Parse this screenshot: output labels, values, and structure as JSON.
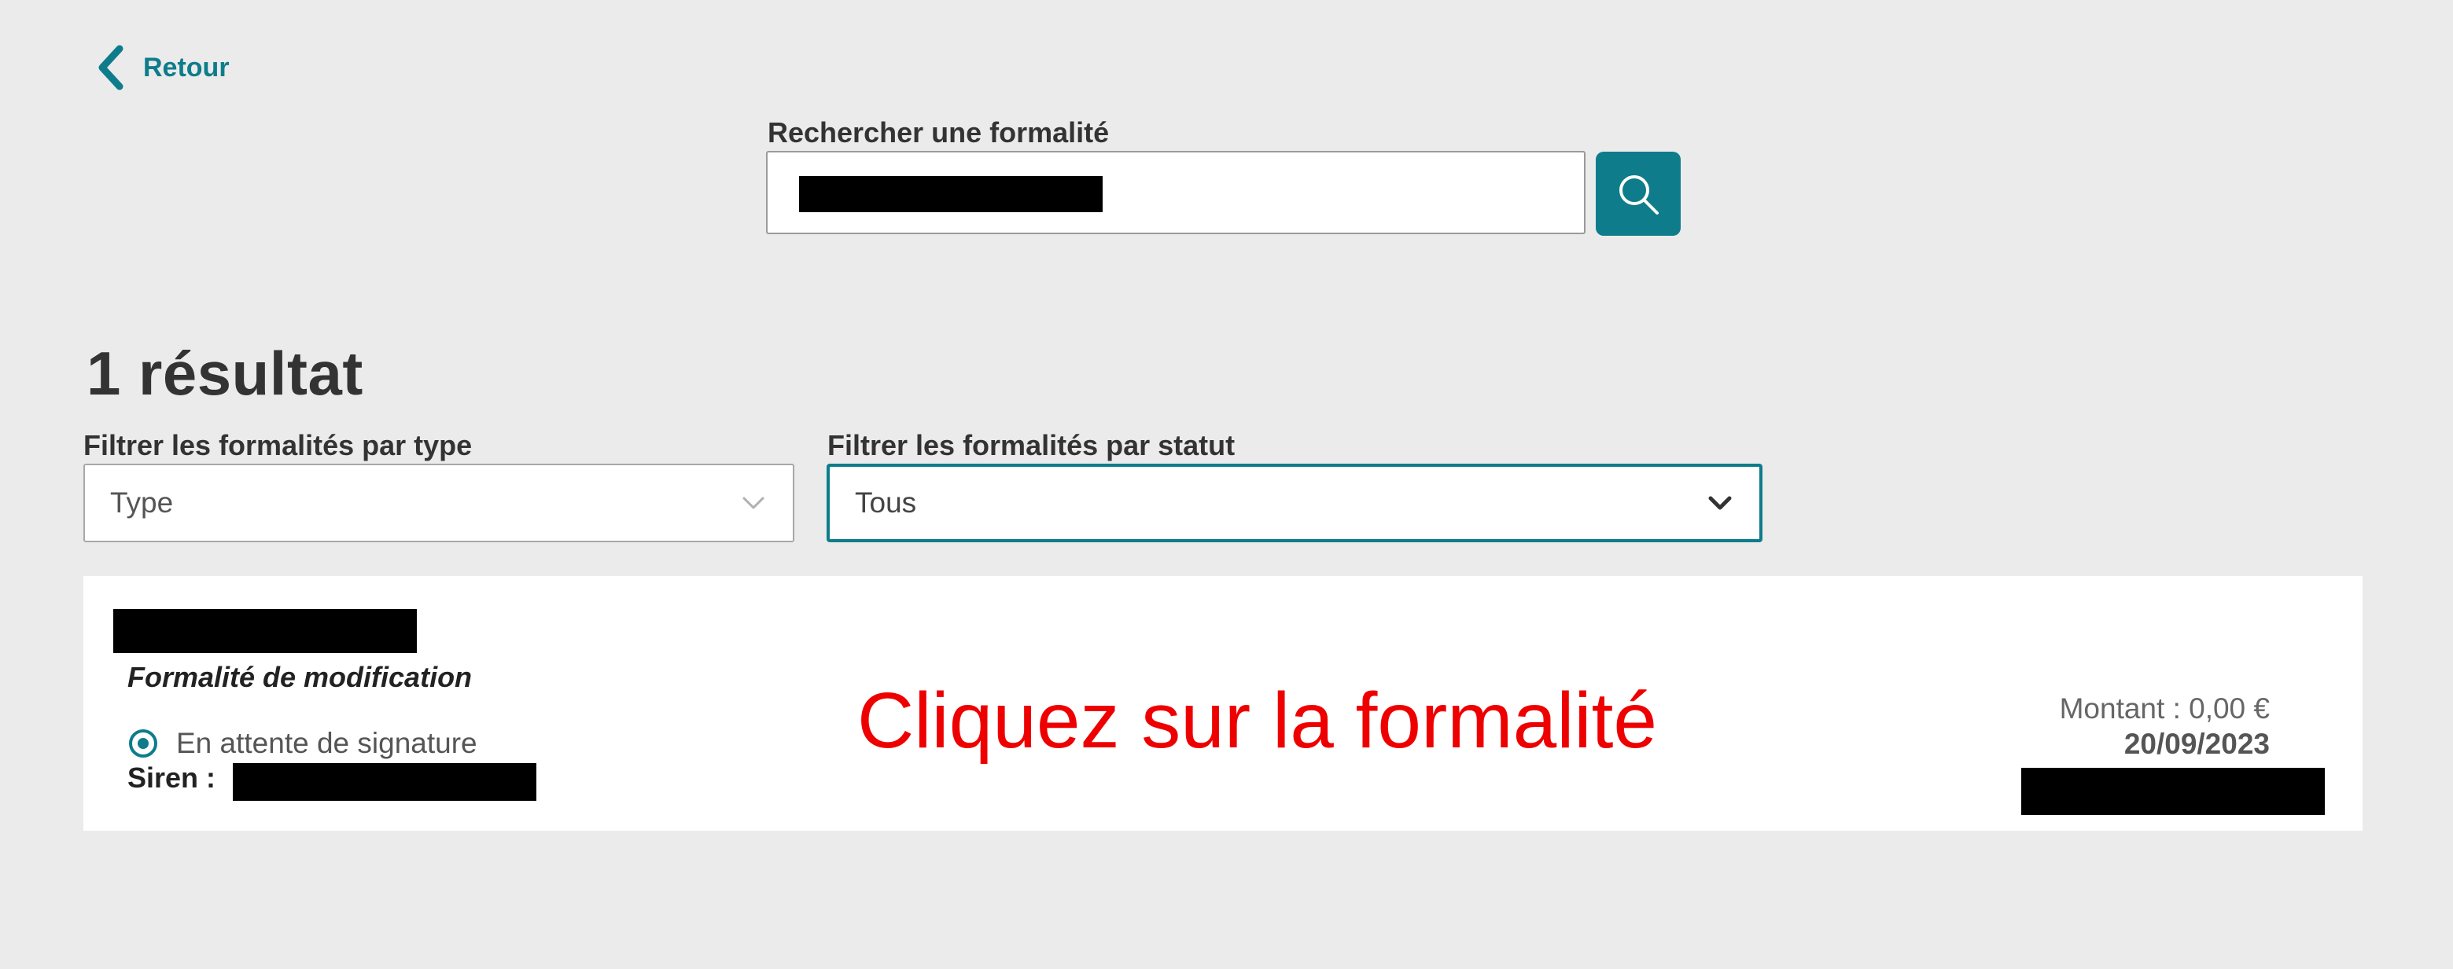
{
  "navigation": {
    "back_label": "Retour"
  },
  "search": {
    "label": "Rechercher une formalité",
    "value_redacted": true,
    "button_icon": "search-icon"
  },
  "results": {
    "heading": "1 résultat"
  },
  "filters": {
    "type": {
      "label": "Filtrer les formalités par type",
      "value": "Type"
    },
    "status": {
      "label": "Filtrer les formalités par statut",
      "value": "Tous"
    }
  },
  "formalities": [
    {
      "title_redacted": true,
      "type": "Formalité de modification",
      "status": "En attente de signature",
      "siren_label": "Siren :",
      "siren_redacted": true,
      "amount": "Montant : 0,00 €",
      "date": "20/09/2023",
      "reference_redacted": true
    }
  ],
  "annotation": {
    "text": "Cliquez sur la formalité",
    "color": "#ee0000"
  },
  "colors": {
    "accent": "#0e7c8b",
    "background": "#ebebeb",
    "card": "#ffffff"
  }
}
